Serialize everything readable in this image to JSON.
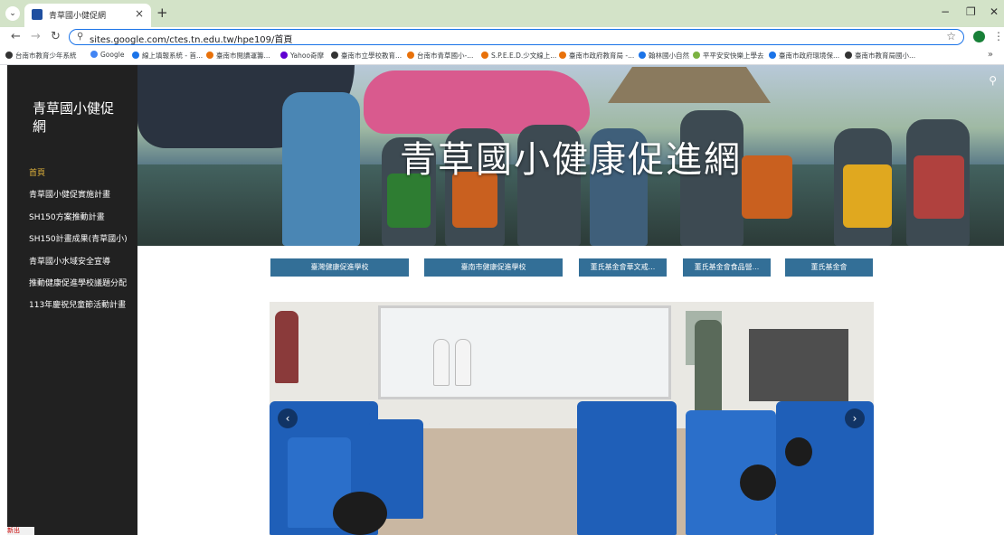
{
  "browser": {
    "tab_title": "青草國小健促網",
    "tab_close": "×",
    "new_tab": "+",
    "url": "sites.google.com/ctes.tn.edu.tw/hpe109/首頁",
    "win_min": "−",
    "win_max": "❐",
    "win_close": "✕",
    "bookmarks": [
      "台南市教育少年系統",
      "Google",
      "線上填報系統 - 首...",
      "臺南市閱讀運籌...",
      "Yahoo奇摩",
      "臺南市立學校教育...",
      "台南市青草國小-...",
      "S.P.E.E.D.少文線上...",
      "臺南市政府教育局 -...",
      "翰林國小自然",
      "平平安安快樂上學去",
      "臺南市政府環境保...",
      "臺南市教育局國小..."
    ]
  },
  "sidebar": {
    "site_title": "青草國小健促網",
    "items": [
      {
        "label": "首頁",
        "active": true
      },
      {
        "label": "青草國小健促實施計畫"
      },
      {
        "label": "SH150方案推動計畫"
      },
      {
        "label": "SH150計畫成果(青草國小)"
      },
      {
        "label": "青草國小水域安全宣導"
      },
      {
        "label": "推動健康促進學校議題分配"
      },
      {
        "label": "113年慶祝兒童節活動計畫"
      }
    ]
  },
  "hero": {
    "title": "青草國小健康促進網"
  },
  "link_buttons": [
    "臺灣健康促進學校",
    "臺南市健康促進學校",
    "董氏基金會華文戒...",
    "董氏基金會食品營...",
    "董氏基金會"
  ],
  "carousel": {
    "prev": "‹",
    "next": "›"
  },
  "taskbar": {
    "fragment": "新出"
  },
  "colors": {
    "sidebar_bg": "#212121",
    "nav_active": "#e0b23b",
    "button_bg": "#336f97",
    "tabbar_bg": "#d3e3c8"
  }
}
